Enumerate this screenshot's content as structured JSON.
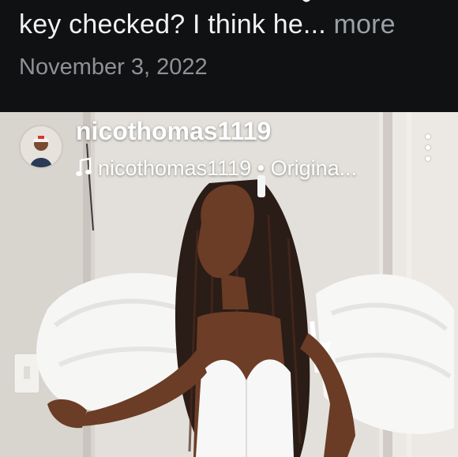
{
  "caption": {
    "text": "key checked? I think he...",
    "more_label": "more",
    "date": "November 3, 2022"
  },
  "post": {
    "username": "nicothomas1119",
    "audio_label": "nicothomas1119 • Origina...",
    "icons": {
      "music": "music-note-icon",
      "more": "more-vertical-icon"
    }
  },
  "colors": {
    "background": "#101113",
    "caption_text": "#f2f2f2",
    "secondary_text": "#8e9296"
  }
}
